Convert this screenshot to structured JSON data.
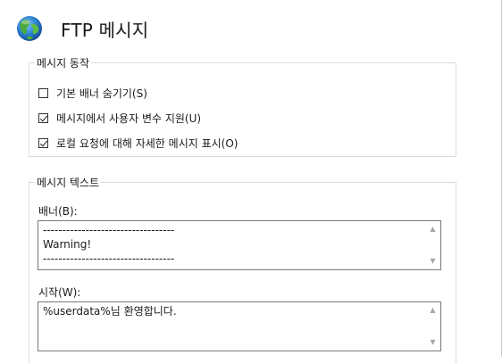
{
  "header": {
    "title": "FTP 메시지",
    "icon": "globe-icon"
  },
  "behavior": {
    "legend": "메시지 동작",
    "options": [
      {
        "label": "기본 배너 숨기기(S)",
        "checked": false
      },
      {
        "label": "메시지에서 사용자 변수 지원(U)",
        "checked": true
      },
      {
        "label": "로컬 요청에 대해 자세한 메시지 표시(O)",
        "checked": true
      }
    ]
  },
  "message_text": {
    "legend": "메시지 텍스트",
    "banner": {
      "label": "배너(B):",
      "value": "----------------------------------\nWarning!\n----------------------------------"
    },
    "welcome": {
      "label": "시작(W):",
      "value": "%userdata%님 환영합니다."
    }
  },
  "colors": {
    "border": "#dcdcdc",
    "textbox_border": "#7a7a7a",
    "scroll_arrow": "#a8a8a8"
  }
}
